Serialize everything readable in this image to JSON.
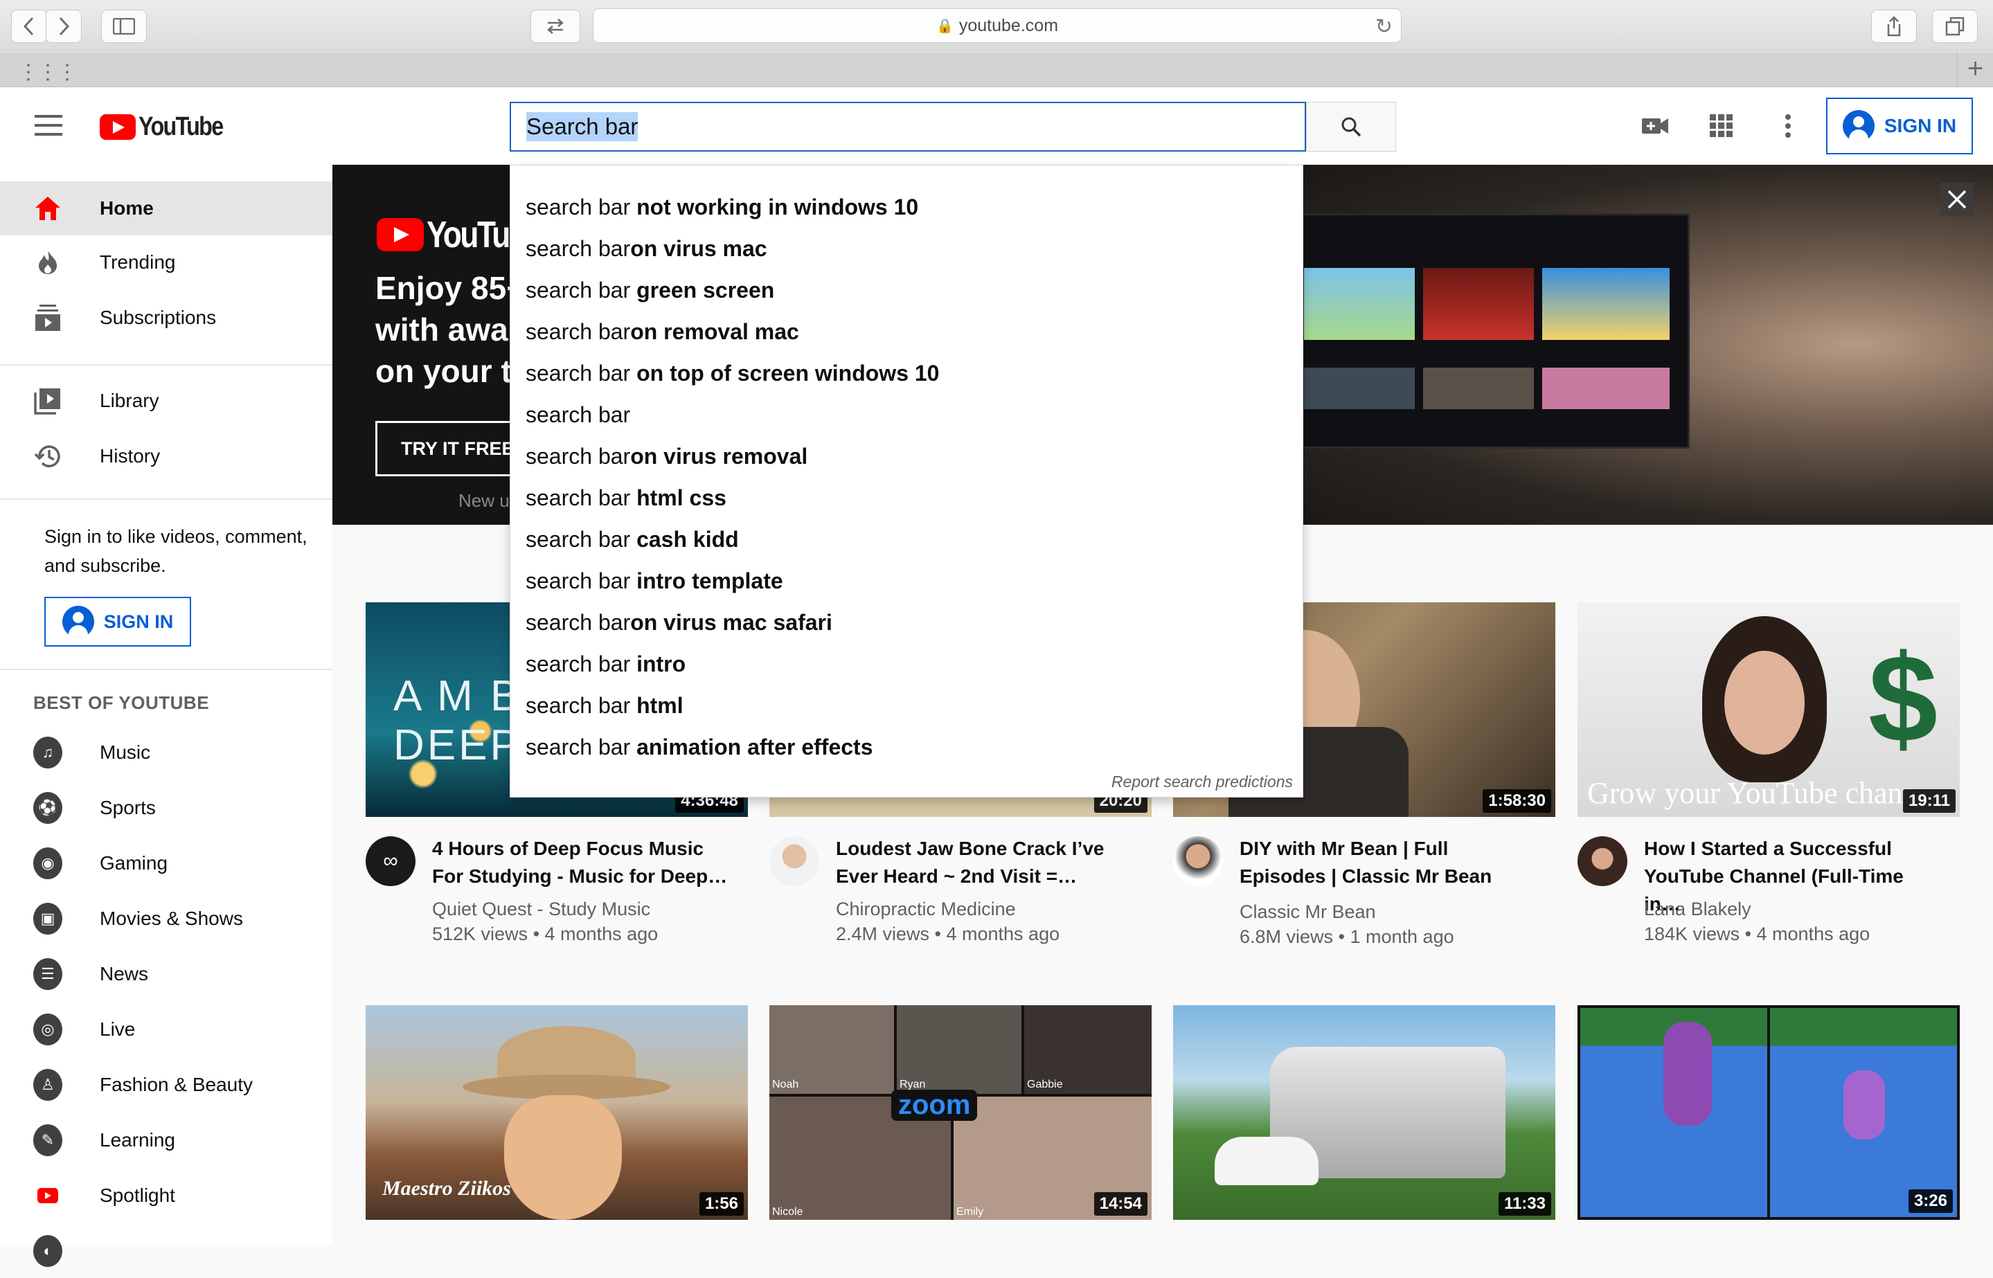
{
  "browser": {
    "url": "youtube.com"
  },
  "masthead": {
    "logo_text": "YouTube",
    "search_value": "Search bar",
    "sign_in_label": "SIGN IN"
  },
  "sidebar": {
    "main": [
      {
        "label": "Home",
        "icon": "home-icon"
      },
      {
        "label": "Trending",
        "icon": "flame-icon"
      },
      {
        "label": "Subscriptions",
        "icon": "subscriptions-icon"
      }
    ],
    "library": [
      {
        "label": "Library",
        "icon": "library-icon"
      },
      {
        "label": "History",
        "icon": "history-icon"
      }
    ],
    "signin_prompt": "Sign in to like videos, comment, and subscribe.",
    "sign_in_label": "SIGN IN",
    "best_heading": "BEST OF YOUTUBE",
    "categories": [
      {
        "label": "Music",
        "icon": "music-icon"
      },
      {
        "label": "Sports",
        "icon": "sports-icon"
      },
      {
        "label": "Gaming",
        "icon": "gaming-icon"
      },
      {
        "label": "Movies & Shows",
        "icon": "movies-icon"
      },
      {
        "label": "News",
        "icon": "news-icon"
      },
      {
        "label": "Live",
        "icon": "live-icon"
      },
      {
        "label": "Fashion & Beauty",
        "icon": "fashion-icon"
      },
      {
        "label": "Learning",
        "icon": "learning-icon"
      },
      {
        "label": "Spotlight",
        "icon": "spotlight-icon"
      }
    ]
  },
  "banner": {
    "logo_text": "YouTub",
    "headline_lines": [
      "Enjoy 85+",
      "with awa",
      "on your t"
    ],
    "cta_label": "TRY IT FREE",
    "small_text": "New u"
  },
  "suggestions": {
    "items": [
      {
        "prefix": "search bar",
        "bold": " not working in windows 10"
      },
      {
        "prefix": "search bar",
        "bold": "on virus mac"
      },
      {
        "prefix": "search bar",
        "bold": " green screen"
      },
      {
        "prefix": "search bar",
        "bold": "on removal mac"
      },
      {
        "prefix": "search bar",
        "bold": " on top of screen windows 10"
      },
      {
        "prefix": "search bar",
        "bold": ""
      },
      {
        "prefix": "search bar",
        "bold": "on virus removal"
      },
      {
        "prefix": "search bar",
        "bold": " html css"
      },
      {
        "prefix": "search bar",
        "bold": " cash kidd"
      },
      {
        "prefix": "search bar",
        "bold": " intro template"
      },
      {
        "prefix": "search bar",
        "bold": "on virus mac safari"
      },
      {
        "prefix": "search bar",
        "bold": " intro"
      },
      {
        "prefix": "search bar",
        "bold": " html"
      },
      {
        "prefix": "search bar",
        "bold": " animation after effects"
      }
    ],
    "report_label": "Report search predictions"
  },
  "videos": [
    {
      "title": "4 Hours of Deep Focus Music For Studying - Music for Deep…",
      "channel": "Quiet Quest - Study Music",
      "meta": "512K views • 4 months ago",
      "duration": "4:36:48",
      "thumb_text": "A M B I E N T  DEEP"
    },
    {
      "title": "Loudest Jaw Bone Crack I’ve Ever Heard ~ 2nd Visit =…",
      "channel": "Chiropractic Medicine",
      "meta": "2.4M views • 4 months ago",
      "duration": "20:20"
    },
    {
      "title": "DIY with Mr Bean | Full Episodes | Classic Mr Bean",
      "channel": "Classic Mr Bean",
      "meta": "6.8M views • 1 month ago",
      "duration": "1:58:30"
    },
    {
      "title": "How I Started a Successful YouTube Channel (Full-Time in…",
      "channel": "Lana Blakely",
      "meta": "184K views • 4 months ago",
      "duration": "19:11",
      "thumb_text": "Grow your YouTube chan"
    },
    {
      "duration": "1:56",
      "thumb_text": "Maestro Ziikos"
    },
    {
      "duration": "14:54",
      "thumb_text": "zoom",
      "names": [
        "Noah",
        "Ryan",
        "Gabbie",
        "Nicole",
        "Emily"
      ]
    },
    {
      "duration": "11:33"
    },
    {
      "duration": "3:26"
    }
  ]
}
